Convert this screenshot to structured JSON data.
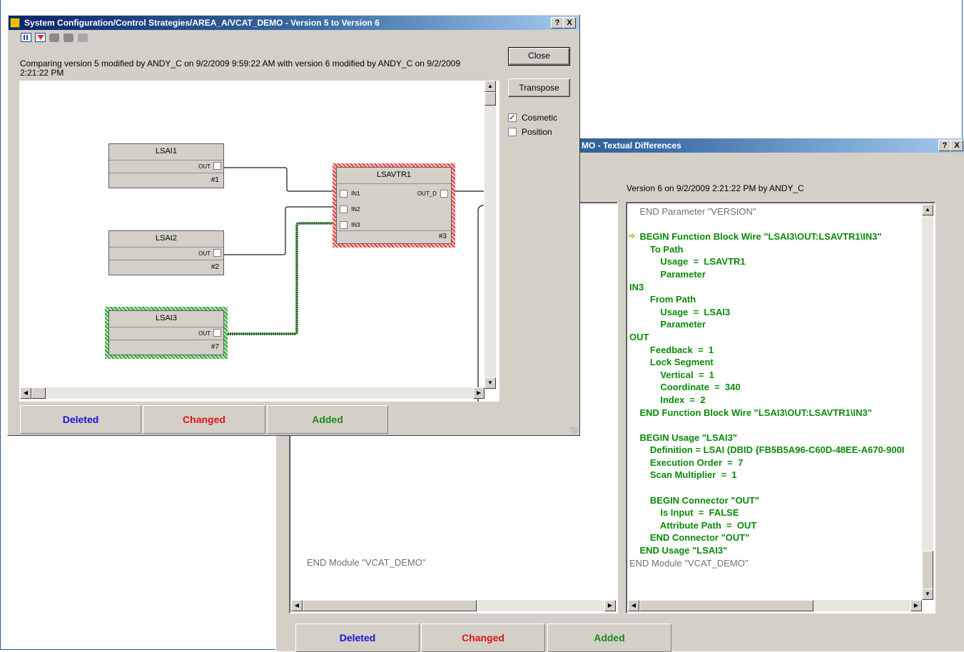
{
  "diagram_window": {
    "title": "System Configuration/Control Strategies/AREA_A/VCAT_DEMO - Version 5 to Version 6",
    "help_button": "?",
    "close_x": "X",
    "comparison_text": "Comparing version 5  modified by ANDY_C on 9/2/2009 9:59:22 AM with version 6  modified by ANDY_C on 9/2/2009 2:21:22 PM",
    "close_button": "Close",
    "transpose_button": "Transpose",
    "cosmetic_label": "Cosmetic",
    "cosmetic_checked": true,
    "position_label": "Position",
    "position_checked": false,
    "legend": {
      "deleted": "Deleted",
      "changed": "Changed",
      "added": "Added"
    },
    "blocks": [
      {
        "name": "LSAI1",
        "out": "OUT",
        "number": "#1"
      },
      {
        "name": "LSAI2",
        "out": "OUT",
        "number": "#2"
      },
      {
        "name": "LSAI3",
        "out": "OUT",
        "number": "#7"
      }
    ],
    "vtr_block": {
      "name": "LSAVTR1",
      "in1": "IN1",
      "in2": "IN2",
      "in3": "IN3",
      "out": "OUT_D",
      "number": "#3"
    }
  },
  "text_window": {
    "title_visible": "MO - Textual Differences",
    "help_button": "?",
    "close_x": "X",
    "version_header": "Version 6 on 9/2/2009 2:21:22 PM by ANDY_C",
    "left_end_line": "END Module \"VCAT_DEMO\"",
    "code_lines": [
      {
        "text": "    END Parameter \"VERSION\"",
        "style": "n"
      },
      {
        "text": "",
        "style": "g"
      },
      {
        "text": "    BEGIN Function Block Wire \"LSAI3\\OUT:LSAVTR1\\IN3\"",
        "style": "g"
      },
      {
        "text": "        To Path",
        "style": "g"
      },
      {
        "text": "            Usage  =  LSAVTR1",
        "style": "g"
      },
      {
        "text": "            Parameter",
        "style": "g"
      },
      {
        "text": "IN3",
        "style": "g"
      },
      {
        "text": "        From Path",
        "style": "g"
      },
      {
        "text": "            Usage  =  LSAI3",
        "style": "g"
      },
      {
        "text": "            Parameter",
        "style": "g"
      },
      {
        "text": "OUT",
        "style": "g"
      },
      {
        "text": "        Feedback  =  1",
        "style": "g"
      },
      {
        "text": "        Lock Segment",
        "style": "g"
      },
      {
        "text": "            Vertical  =  1",
        "style": "g"
      },
      {
        "text": "            Coordinate  =  340",
        "style": "g"
      },
      {
        "text": "            Index  =  2",
        "style": "g"
      },
      {
        "text": "    END Function Block Wire \"LSAI3\\OUT:LSAVTR1\\IN3\"",
        "style": "g"
      },
      {
        "text": "",
        "style": "g"
      },
      {
        "text": "    BEGIN Usage \"LSAI3\"",
        "style": "g"
      },
      {
        "text": "        Definition = LSAI (DBID {FB5B5A96-C60D-48EE-A670-900I",
        "style": "g"
      },
      {
        "text": "        Execution Order  =  7",
        "style": "g"
      },
      {
        "text": "        Scan Multiplier  =  1",
        "style": "g"
      },
      {
        "text": "",
        "style": "g"
      },
      {
        "text": "        BEGIN Connector \"OUT\"",
        "style": "g"
      },
      {
        "text": "            Is Input  =  FALSE",
        "style": "g"
      },
      {
        "text": "            Attribute Path  =  OUT",
        "style": "g"
      },
      {
        "text": "        END Connector \"OUT\"",
        "style": "g"
      },
      {
        "text": "    END Usage \"LSAI3\"",
        "style": "g"
      },
      {
        "text": "END Module \"VCAT_DEMO\"",
        "style": "n"
      }
    ],
    "legend": {
      "deleted": "Deleted",
      "changed": "Changed",
      "added": "Added"
    }
  },
  "colors": {
    "deleted": "#1414d8",
    "changed": "#e01414",
    "added": "#1a8a1a",
    "code_added": "#0a8a0a"
  }
}
